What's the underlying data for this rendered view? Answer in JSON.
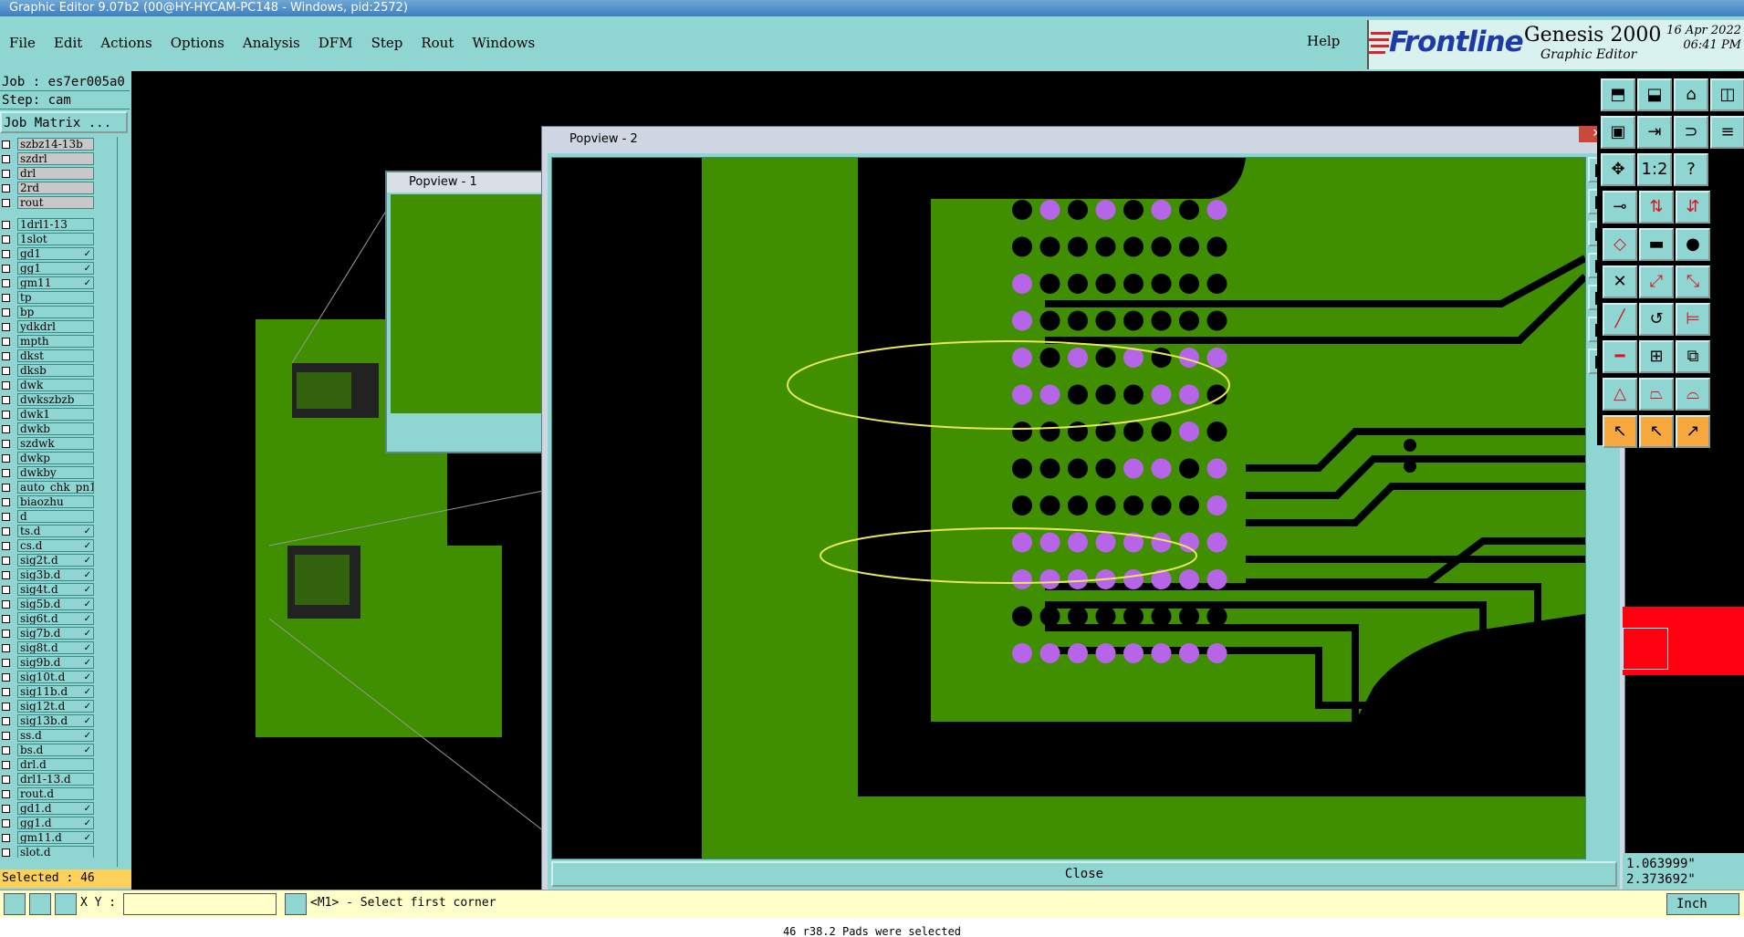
{
  "window": {
    "title": "Graphic Editor 9.07b2 (00@HY-HYCAM-PC148 - Windows, pid:2572)"
  },
  "menu": {
    "items": [
      "File",
      "Edit",
      "Actions",
      "Options",
      "Analysis",
      "DFM",
      "Step",
      "Rout",
      "Windows"
    ],
    "help": "Help"
  },
  "brand": {
    "logo": "Frontline",
    "product": "Genesis 2000",
    "subtitle": "Graphic Editor",
    "date": "16 Apr 2022",
    "time": "06:41 PM"
  },
  "job": {
    "job_label": "Job : es7er005a0",
    "step_label": "Step: cam",
    "matrix_button": "Job Matrix ..."
  },
  "layers_top": [
    {
      "name": "szbz14-13b",
      "grey": true
    },
    {
      "name": "szdrl",
      "grey": true
    },
    {
      "name": "drl",
      "grey": true
    },
    {
      "name": "2rd",
      "grey": true
    },
    {
      "name": "rout",
      "grey": true
    }
  ],
  "layers": [
    {
      "name": "1drl1-13",
      "flag": ""
    },
    {
      "name": "1slot",
      "flag": ""
    },
    {
      "name": "gd1",
      "flag": "✓"
    },
    {
      "name": "gg1",
      "flag": "✓"
    },
    {
      "name": "gm11",
      "flag": "✓"
    },
    {
      "name": "tp",
      "flag": ""
    },
    {
      "name": "bp",
      "flag": ""
    },
    {
      "name": "ydkdrl",
      "flag": ""
    },
    {
      "name": "mpth",
      "flag": ""
    },
    {
      "name": "dkst",
      "flag": ""
    },
    {
      "name": "dksb",
      "flag": ""
    },
    {
      "name": "dwk",
      "flag": ""
    },
    {
      "name": "dwkszbzb",
      "flag": ""
    },
    {
      "name": "dwk1",
      "flag": ""
    },
    {
      "name": "dwkb",
      "flag": ""
    },
    {
      "name": "szdwk",
      "flag": ""
    },
    {
      "name": "dwkp",
      "flag": ""
    },
    {
      "name": "dwkby",
      "flag": ""
    },
    {
      "name": "auto_chk_pn1",
      "flag": ""
    },
    {
      "name": "biaozhu",
      "flag": ""
    },
    {
      "name": "d",
      "flag": ""
    },
    {
      "name": "ts.d",
      "flag": "✓"
    },
    {
      "name": "cs.d",
      "flag": "✓"
    },
    {
      "name": "sig2t.d",
      "flag": "✓"
    },
    {
      "name": "sig3b.d",
      "flag": "✓"
    },
    {
      "name": "sig4t.d",
      "flag": "✓"
    },
    {
      "name": "sig5b.d",
      "flag": "✓"
    },
    {
      "name": "sig6t.d",
      "flag": "✓"
    },
    {
      "name": "sig7b.d",
      "flag": "✓"
    },
    {
      "name": "sig8t.d",
      "flag": "✓"
    },
    {
      "name": "sig9b.d",
      "flag": "✓"
    },
    {
      "name": "sig10t.d",
      "flag": "✓"
    },
    {
      "name": "sig11b.d",
      "flag": "✓"
    },
    {
      "name": "sig12t.d",
      "flag": "✓"
    },
    {
      "name": "sig13b.d",
      "flag": "✓"
    },
    {
      "name": "ss.d",
      "flag": "✓"
    },
    {
      "name": "bs.d",
      "flag": "✓"
    },
    {
      "name": "drl.d",
      "flag": ""
    },
    {
      "name": "drl1-13.d",
      "flag": ""
    },
    {
      "name": "rout.d",
      "flag": ""
    },
    {
      "name": "gd1.d",
      "flag": "✓"
    },
    {
      "name": "gg1.d",
      "flag": "✓"
    },
    {
      "name": "gm11.d",
      "flag": "✓"
    },
    {
      "name": "slot.d",
      "flag": ""
    }
  ],
  "selected": "Selected : 46",
  "popview1": {
    "title": "Popview - 1"
  },
  "popview2": {
    "title": "Popview - 2",
    "close_label": "Close",
    "x_label": "✕"
  },
  "colors": {
    "board": "#3f8f00",
    "pad": "#b665e8",
    "selection": "#e8e85a",
    "panel": "#8fd6d3"
  },
  "coords": {
    "x": "1.063999\"",
    "y": "2.373692\""
  },
  "status": {
    "xy_label": "X Y :",
    "xy_value": "",
    "prompt": "<M1> - Select first corner",
    "units": "Inch",
    "bottom_message": "46 r38.2 Pads were selected"
  }
}
